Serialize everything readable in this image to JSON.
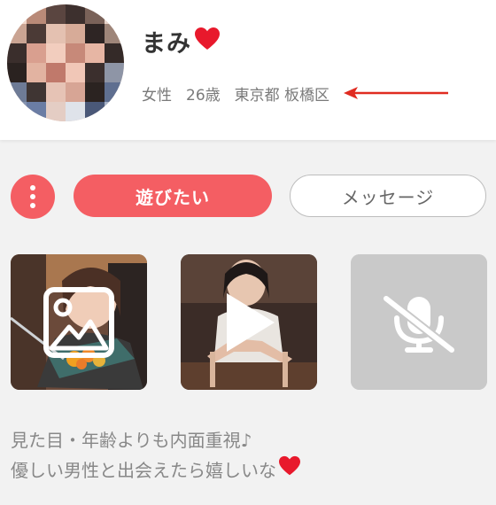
{
  "profile": {
    "name": "まみ",
    "gender": "女性",
    "age": "26歳",
    "location": "東京都 板橋区"
  },
  "actions": {
    "play_label": "遊びたい",
    "message_label": "メッセージ"
  },
  "media": [
    {
      "type": "photo",
      "icon": "image-icon"
    },
    {
      "type": "video",
      "icon": "play-icon"
    },
    {
      "type": "voice",
      "icon": "mic-off-icon"
    }
  ],
  "bio": {
    "line1": "見た目・年齢よりも内面重視♪",
    "line2": "優しい男性と出会えたら嬉しいな"
  },
  "colors": {
    "accent": "#f45e63",
    "heart": "#e8192c",
    "arrow": "#e02b20"
  }
}
